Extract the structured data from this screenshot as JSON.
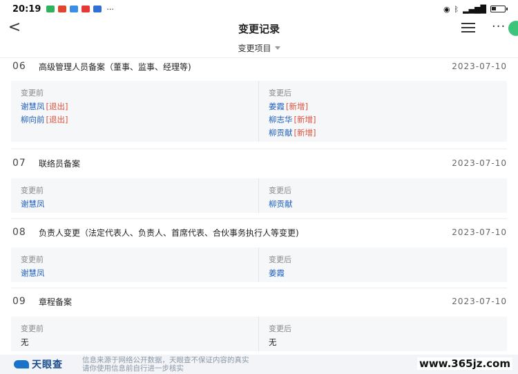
{
  "status_bar": {
    "time": "20:19",
    "more_dots": "···"
  },
  "header": {
    "back_label": "<",
    "title": "变更记录",
    "more_label": "···"
  },
  "filter": {
    "label": "变更项目"
  },
  "labels": {
    "before": "变更前",
    "after": "变更后"
  },
  "records": [
    {
      "num": "06",
      "title": "高级管理人员备案（董事、监事、经理等)",
      "date": "2023-07-10",
      "before": [
        {
          "name": "谢慧凤",
          "tag": "[退出]"
        },
        {
          "name": "柳向前",
          "tag": "[退出]"
        }
      ],
      "after": [
        {
          "name": "姜霞",
          "tag": "[新增]"
        },
        {
          "name": "柳志华",
          "tag": "[新增]"
        },
        {
          "name": "柳贡献",
          "tag": "[新增]"
        }
      ]
    },
    {
      "num": "07",
      "title": "联络员备案",
      "date": "2023-07-10",
      "before": [
        {
          "name": "谢慧凤"
        }
      ],
      "after": [
        {
          "name": "柳贡献"
        }
      ]
    },
    {
      "num": "08",
      "title": "负责人变更（法定代表人、负责人、首席代表、合伙事务执行人等变更)",
      "date": "2023-07-10",
      "before": [
        {
          "name": "谢慧凤"
        }
      ],
      "after": [
        {
          "name": "姜霞"
        }
      ]
    },
    {
      "num": "09",
      "title": "章程备案",
      "date": "2023-07-10",
      "before": [
        {
          "text": "无"
        }
      ],
      "after": [
        {
          "text": "无"
        }
      ]
    }
  ],
  "footer": {
    "logo_text": "天眼查",
    "note_line1": "信息来源于网络公开数据，天眼查不保证内容的真实",
    "note_line2": "请你使用信息前自行进一步核实",
    "watermark": "www.365jz.com"
  },
  "colors": {
    "link": "#1f5fbf",
    "tag": "#e0503a",
    "accent_green": "#3cc47c",
    "brand": "#1a73c9"
  }
}
